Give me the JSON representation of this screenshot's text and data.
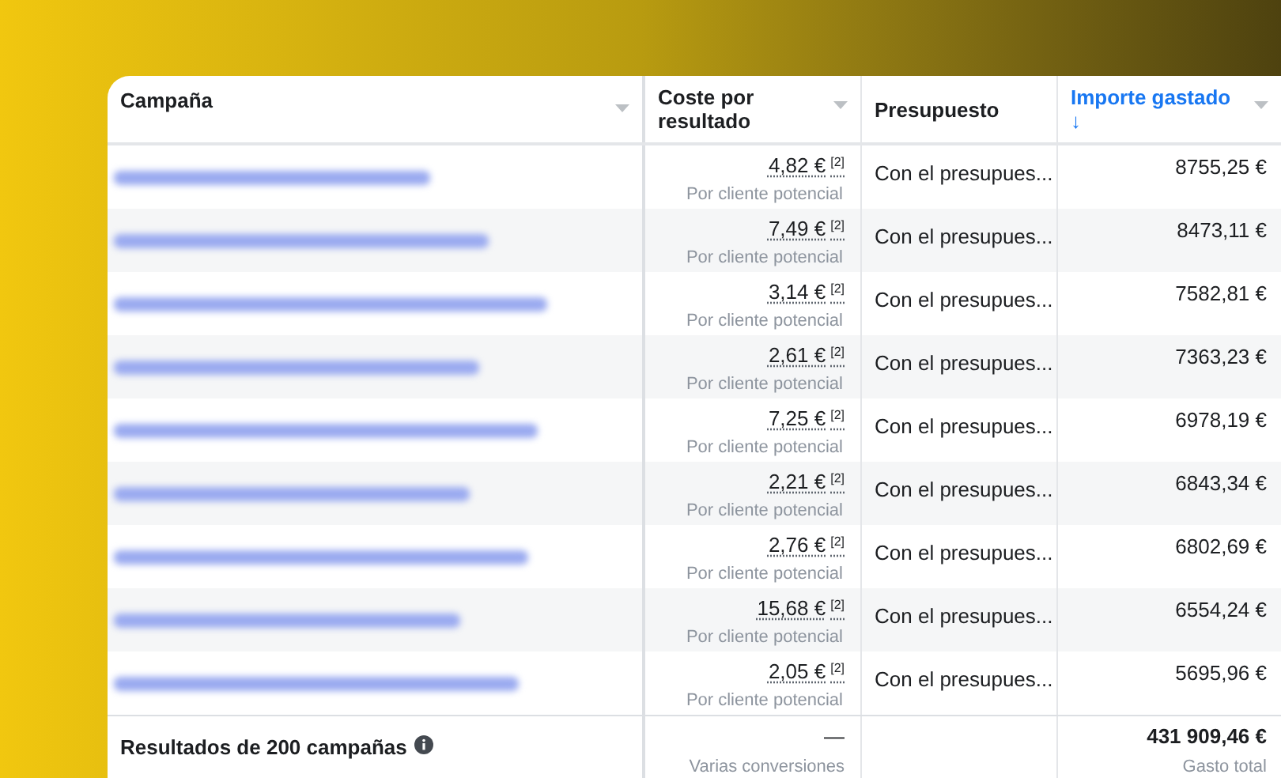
{
  "table": {
    "columns": [
      {
        "label": "Campaña",
        "sorted": false,
        "menu": true
      },
      {
        "label": "Coste por resultado",
        "sorted": false,
        "menu": true
      },
      {
        "label": "Presupuesto",
        "sorted": false,
        "menu": false
      },
      {
        "label": "Importe gastado",
        "sorted": true,
        "sort_arrow": "↓",
        "menu": true
      }
    ],
    "rows": [
      {
        "cost": "4,82 €$^{[2]}$",
        "cost_note": "Por cliente potencial",
        "budget": "Con el presupues...",
        "spent": "8755,25 €"
      },
      {
        "cost": "7,49 €$^{[2]}$",
        "cost_note": "Por cliente potencial",
        "budget": "Con el presupues...",
        "spent": "8473,11 €"
      },
      {
        "cost": "3,14 €$^{[2]}$",
        "cost_note": "Por cliente potencial",
        "budget": "Con el presupues...",
        "spent": "7582,81 €"
      },
      {
        "cost": "2,61 €$^{[2]}$",
        "cost_note": "Por cliente potencial",
        "budget": "Con el presupues...",
        "spent": "7363,23 €"
      },
      {
        "cost": "7,25 €$^{[2]}$",
        "cost_note": "Por cliente potencial",
        "budget": "Con el presupues...",
        "spent": "6978,19 €"
      },
      {
        "cost": "2,21 €$^{[2]}$",
        "cost_note": "Por cliente potencial",
        "budget": "Con el presupues...",
        "spent": "6843,34 €"
      },
      {
        "cost": "2,76 €$^{[2]}$",
        "cost_note": "Por cliente potencial",
        "budget": "Con el presupues...",
        "spent": "6802,69 €"
      },
      {
        "cost": "15,68 €$^{[2]}$",
        "cost_note": "Por cliente potencial",
        "budget": "Con el presupues...",
        "spent": "6554,24 €"
      },
      {
        "cost": "2,05 €$^{[2]}$",
        "cost_note": "Por cliente potencial",
        "budget": "Con el presupues...",
        "spent": "5695,96 €"
      }
    ],
    "footer": {
      "label": "Resultados de 200 campañas",
      "cost": "—",
      "cost_note": "Varias conversiones",
      "spent": "431 909,46 €",
      "spent_note": "Gasto total"
    }
  }
}
